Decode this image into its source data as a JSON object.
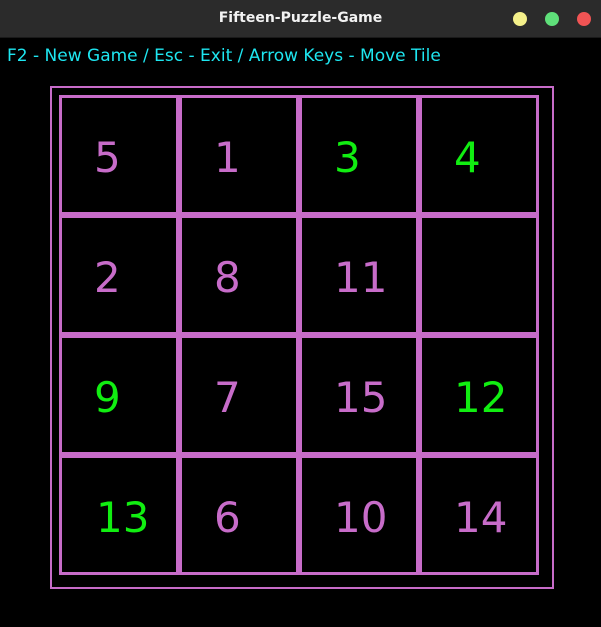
{
  "window": {
    "title": "Fifteen-Puzzle-Game"
  },
  "hint": "F2 - New Game / Esc - Exit / Arrow Keys - Move Tile",
  "colors": {
    "frame": "#c76cc9",
    "tile_misplaced": "#c76cc9",
    "tile_correct": "#11ee11",
    "hint": "#1ee6f0",
    "background": "#000000"
  },
  "board": {
    "rows": [
      [
        {
          "value": "5",
          "state": "misplaced"
        },
        {
          "value": "1",
          "state": "misplaced"
        },
        {
          "value": "3",
          "state": "correct"
        },
        {
          "value": "4",
          "state": "correct"
        }
      ],
      [
        {
          "value": "2",
          "state": "misplaced"
        },
        {
          "value": "8",
          "state": "misplaced"
        },
        {
          "value": "11",
          "state": "misplaced"
        },
        {
          "value": "",
          "state": "empty"
        }
      ],
      [
        {
          "value": "9",
          "state": "correct"
        },
        {
          "value": "7",
          "state": "misplaced"
        },
        {
          "value": "15",
          "state": "misplaced"
        },
        {
          "value": "12",
          "state": "correct"
        }
      ],
      [
        {
          "value": "13",
          "state": "correct"
        },
        {
          "value": "6",
          "state": "misplaced"
        },
        {
          "value": "10",
          "state": "misplaced"
        },
        {
          "value": "14",
          "state": "misplaced"
        }
      ]
    ]
  }
}
